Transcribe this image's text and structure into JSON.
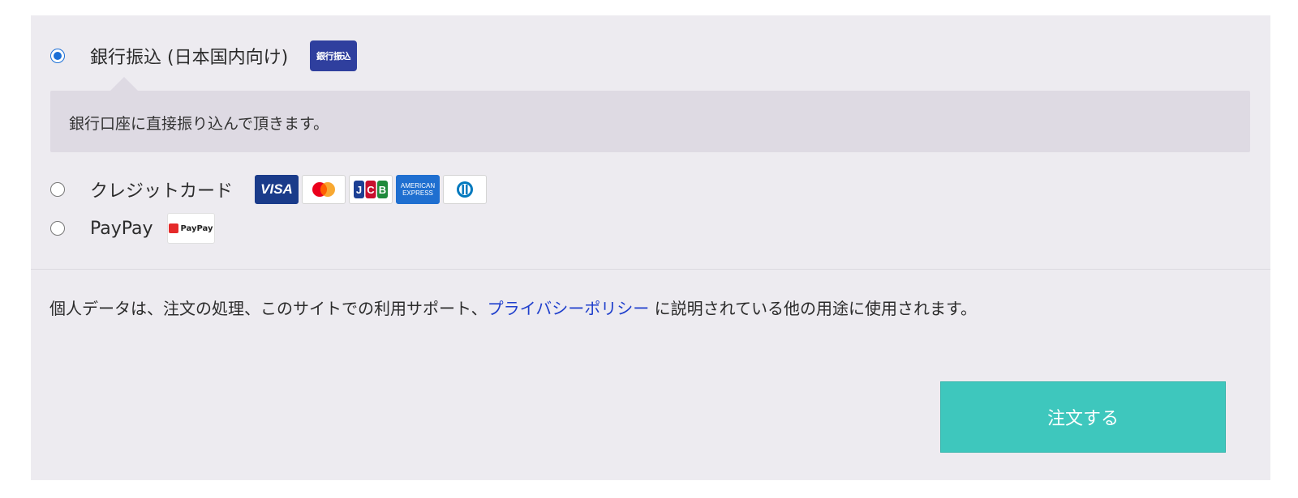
{
  "payment_methods": [
    {
      "label": "銀行振込 (日本国内向け)",
      "selected": true,
      "badge_text": "銀行振込",
      "description": "銀行口座に直接振り込んで頂きます。"
    },
    {
      "label": "クレジットカード",
      "selected": false,
      "card_logos": [
        {
          "name": "visa-logo",
          "text": "VISA"
        },
        {
          "name": "mastercard-logo",
          "text": ""
        },
        {
          "name": "jcb-logo",
          "text": "JCB"
        },
        {
          "name": "amex-logo",
          "text": "AMERICAN EXPRESS"
        },
        {
          "name": "diners-logo",
          "text": ""
        }
      ]
    },
    {
      "label": "PayPay",
      "selected": false,
      "logo_text": "PayPay"
    }
  ],
  "privacy_notice": {
    "before_link": "個人データは、注文の処理、このサイトでの利用サポート、",
    "link_text": "プライバシーポリシー",
    "after_link": " に説明されている他の用途に使用されます。"
  },
  "order_button_label": "注文する",
  "colors": {
    "panel_bg": "#edebf0",
    "description_bg": "#dedae3",
    "radio_selected": "#1b6fd6",
    "link": "#1f3fcc",
    "order_button": "#3ec7bd"
  }
}
